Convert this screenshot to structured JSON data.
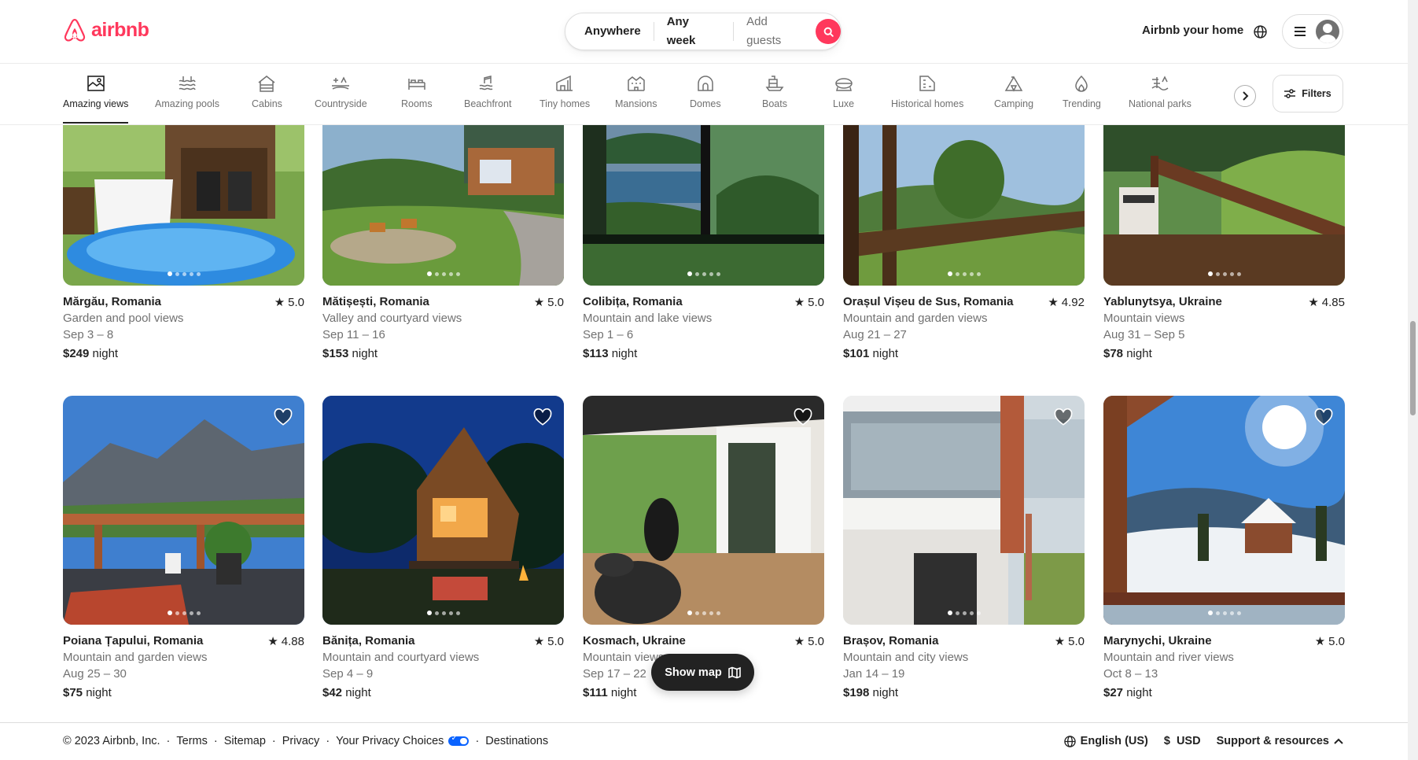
{
  "header": {
    "logo_text": "airbnb",
    "search": {
      "location": "Anywhere",
      "dates": "Any week",
      "guests_placeholder": "Add guests"
    },
    "host_link": "Airbnb your home"
  },
  "categories": [
    {
      "label": "Amazing views",
      "icon": "amazing-views-icon",
      "active": true
    },
    {
      "label": "Amazing pools",
      "icon": "pool-icon"
    },
    {
      "label": "Cabins",
      "icon": "cabin-icon"
    },
    {
      "label": "Countryside",
      "icon": "countryside-icon"
    },
    {
      "label": "Rooms",
      "icon": "bed-icon"
    },
    {
      "label": "Beachfront",
      "icon": "beachfront-icon"
    },
    {
      "label": "Tiny homes",
      "icon": "tiny-home-icon"
    },
    {
      "label": "Mansions",
      "icon": "mansion-icon"
    },
    {
      "label": "Domes",
      "icon": "dome-icon"
    },
    {
      "label": "Boats",
      "icon": "boat-icon"
    },
    {
      "label": "Luxe",
      "icon": "luxe-icon"
    },
    {
      "label": "Historical homes",
      "icon": "historical-home-icon"
    },
    {
      "label": "Camping",
      "icon": "camping-icon"
    },
    {
      "label": "Trending",
      "icon": "flame-icon"
    },
    {
      "label": "National parks",
      "icon": "national-park-icon"
    }
  ],
  "filters_label": "Filters",
  "listings": [
    {
      "location": "Mărgău, Romania",
      "rating": "5.0",
      "description": "Garden and pool views",
      "dates": "Sep 3 – 8",
      "price": "$249",
      "price_unit": "night"
    },
    {
      "location": "Mătișești, Romania",
      "rating": "5.0",
      "description": "Valley and courtyard views",
      "dates": "Sep 11 – 16",
      "price": "$153",
      "price_unit": "night"
    },
    {
      "location": "Colibița, Romania",
      "rating": "5.0",
      "description": "Mountain and lake views",
      "dates": "Sep 1 – 6",
      "price": "$113",
      "price_unit": "night"
    },
    {
      "location": "Orașul Vișeu de Sus, Romania",
      "rating": "4.92",
      "description": "Mountain and garden views",
      "dates": "Aug 21 – 27",
      "price": "$101",
      "price_unit": "night"
    },
    {
      "location": "Yablunytsya, Ukraine",
      "rating": "4.85",
      "description": "Mountain views",
      "dates": "Aug 31 – Sep 5",
      "price": "$78",
      "price_unit": "night"
    },
    {
      "location": "Poiana Țapului, Romania",
      "rating": "4.88",
      "description": "Mountain and garden views",
      "dates": "Aug 25 – 30",
      "price": "$75",
      "price_unit": "night"
    },
    {
      "location": "Bănița, Romania",
      "rating": "5.0",
      "description": "Mountain and courtyard views",
      "dates": "Sep 4 – 9",
      "price": "$42",
      "price_unit": "night"
    },
    {
      "location": "Kosmach, Ukraine",
      "rating": "5.0",
      "description": "Mountain views",
      "dates": "Sep 17 – 22",
      "price": "$111",
      "price_unit": "night"
    },
    {
      "location": "Brașov, Romania",
      "rating": "5.0",
      "description": "Mountain and city views",
      "dates": "Jan 14 – 19",
      "price": "$198",
      "price_unit": "night"
    },
    {
      "location": "Marynychi, Ukraine",
      "rating": "5.0",
      "description": "Mountain and river views",
      "dates": "Oct 8 – 13",
      "price": "$27",
      "price_unit": "night"
    }
  ],
  "show_map_label": "Show map",
  "footer": {
    "copyright": "© 2023 Airbnb, Inc.",
    "links": [
      "Terms",
      "Sitemap",
      "Privacy",
      "Your Privacy Choices",
      "Destinations"
    ],
    "language": "English (US)",
    "currency_symbol": "$",
    "currency": "USD",
    "support": "Support & resources"
  },
  "colors": {
    "brand": "#ff385c",
    "text": "#222222",
    "muted": "#717171"
  }
}
